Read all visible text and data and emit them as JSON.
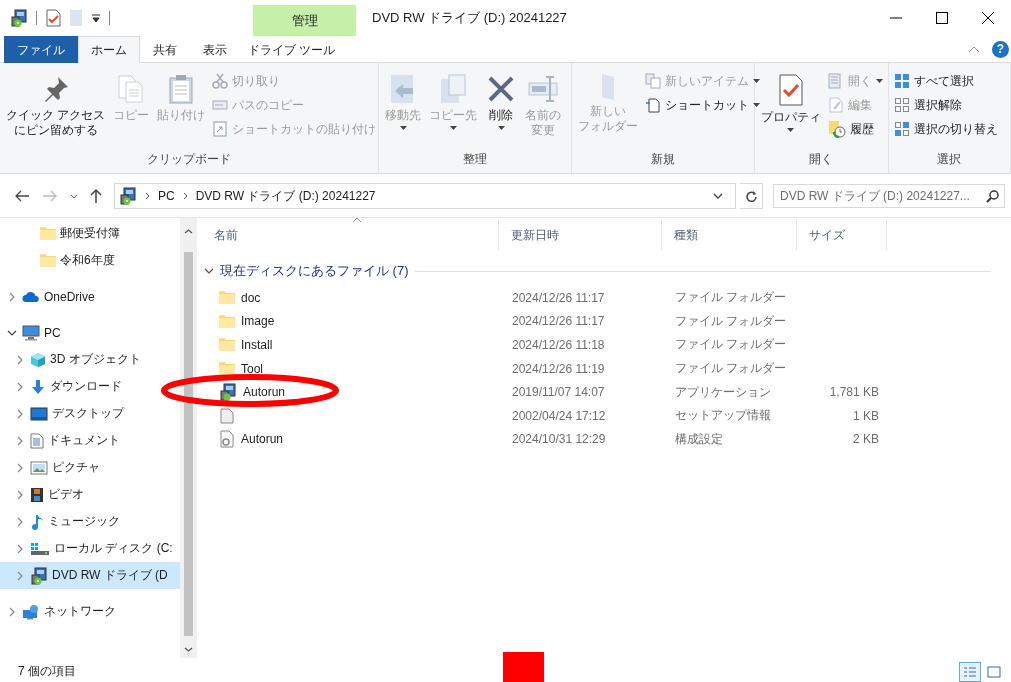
{
  "window": {
    "title": "DVD RW ドライブ (D:) 20241227",
    "context_tab_header": "管理"
  },
  "tabs": [
    {
      "label": "ファイル",
      "kind": "file",
      "selected": false
    },
    {
      "label": "ホーム",
      "kind": "tab",
      "selected": true
    },
    {
      "label": "共有",
      "kind": "tab",
      "selected": false
    },
    {
      "label": "表示",
      "kind": "tab",
      "selected": false
    },
    {
      "label": "ドライブ ツール",
      "kind": "context",
      "selected": false
    }
  ],
  "ribbon_groups": [
    {
      "label": "クリップボード",
      "items": [
        {
          "kind": "large",
          "label_lines": [
            "クイック アクセス",
            "にピン留めする"
          ],
          "disabled": false,
          "has_menu": false
        },
        {
          "kind": "large",
          "label": "コピー",
          "disabled": true,
          "has_menu": false
        },
        {
          "kind": "large",
          "label": "貼り付け",
          "disabled": true,
          "has_menu": false
        },
        {
          "kind": "small",
          "label": "切り取り",
          "disabled": true,
          "has_menu": false
        },
        {
          "kind": "small",
          "label": "パスのコピー",
          "disabled": true,
          "has_menu": false
        },
        {
          "kind": "small",
          "label": "ショートカットの貼り付け",
          "disabled": true,
          "has_menu": false
        }
      ]
    },
    {
      "label": "整理",
      "items": [
        {
          "kind": "large",
          "label": "移動先",
          "disabled": true,
          "has_menu": true
        },
        {
          "kind": "large",
          "label": "コピー先",
          "disabled": true,
          "has_menu": true
        },
        {
          "kind": "large",
          "label": "削除",
          "disabled": false,
          "has_menu": true
        },
        {
          "kind": "large",
          "label_lines": [
            "名前の",
            "変更"
          ],
          "disabled": true,
          "has_menu": false
        }
      ]
    },
    {
      "label": "新規",
      "items": [
        {
          "kind": "large",
          "label_lines": [
            "新しい",
            "フォルダー"
          ],
          "disabled": true,
          "has_menu": false
        },
        {
          "kind": "small",
          "label": "新しいアイテム",
          "disabled": true,
          "has_menu": true
        },
        {
          "kind": "small",
          "label": "ショートカット",
          "disabled": false,
          "has_menu": true
        }
      ]
    },
    {
      "label": "開く",
      "items": [
        {
          "kind": "large",
          "label": "プロパティ",
          "disabled": false,
          "has_menu": true
        },
        {
          "kind": "small",
          "label": "開く",
          "disabled": true,
          "has_menu": true
        },
        {
          "kind": "small",
          "label": "編集",
          "disabled": true,
          "has_menu": false
        },
        {
          "kind": "small",
          "label": "履歴",
          "disabled": false,
          "has_menu": false
        }
      ]
    },
    {
      "label": "選択",
      "items": [
        {
          "kind": "small",
          "label": "すべて選択",
          "disabled": false,
          "has_menu": false
        },
        {
          "kind": "small",
          "label": "選択解除",
          "disabled": false,
          "has_menu": false
        },
        {
          "kind": "small",
          "label": "選択の切り替え",
          "disabled": false,
          "has_menu": false
        }
      ]
    }
  ],
  "help_button": "?",
  "address_bar": {
    "breadcrumbs": [
      "PC",
      "DVD RW ドライブ (D:) 20241227"
    ]
  },
  "search": {
    "placeholder": "DVD RW ドライブ (D:) 20241227..."
  },
  "navigation_pane": {
    "quick_access_items": [
      {
        "label": "郵便受付簿",
        "kind": "folder",
        "selected": false
      },
      {
        "label": "令和6年度",
        "kind": "folder",
        "selected": false
      }
    ],
    "tree": [
      {
        "label": "OneDrive",
        "kind": "cloud",
        "expanded": false,
        "selected": false
      },
      {
        "label": "PC",
        "kind": "pc",
        "expanded": true,
        "selected": false,
        "children": [
          {
            "label": "3D オブジェクト",
            "kind": "cube",
            "expanded": false,
            "selected": false
          },
          {
            "label": "ダウンロード",
            "kind": "download",
            "expanded": false,
            "selected": false
          },
          {
            "label": "デスクトップ",
            "kind": "desktop",
            "expanded": false,
            "selected": false
          },
          {
            "label": "ドキュメント",
            "kind": "document",
            "expanded": false,
            "selected": false
          },
          {
            "label": "ピクチャ",
            "kind": "pictures",
            "expanded": false,
            "selected": false
          },
          {
            "label": "ビデオ",
            "kind": "video",
            "expanded": false,
            "selected": false
          },
          {
            "label": "ミュージック",
            "kind": "music",
            "expanded": false,
            "selected": false
          },
          {
            "label": "ローカル ディスク (C:",
            "kind": "drive",
            "expanded": false,
            "selected": false
          },
          {
            "label": "DVD RW ドライブ (D",
            "kind": "dvd",
            "expanded": false,
            "selected": true
          }
        ]
      },
      {
        "label": "ネットワーク",
        "kind": "network",
        "expanded": false,
        "selected": false
      }
    ]
  },
  "file_list": {
    "columns": [
      "名前",
      "更新日時",
      "種類",
      "サイズ"
    ],
    "group": {
      "label": "現在ディスクにあるファイル (7)",
      "expanded": true
    },
    "rows": [
      {
        "name": "doc",
        "modified": "2024/12/26 11:17",
        "type": "ファイル フォルダー",
        "kind": "folder",
        "selected": false
      },
      {
        "name": "Image",
        "modified": "2024/12/26 11:17",
        "type": "ファイル フォルダー",
        "kind": "folder",
        "selected": false
      },
      {
        "name": "Install",
        "modified": "2024/12/26 11:18",
        "type": "ファイル フォルダー",
        "kind": "folder",
        "selected": false
      },
      {
        "name": "Tool",
        "modified": "2024/12/26 11:19",
        "type": "ファイル フォルダー",
        "kind": "folder",
        "selected": false
      },
      {
        "name": "Autorun",
        "modified": "2019/11/07 14:07",
        "type": "アプリケーション",
        "size": "1,781 KB",
        "kind": "app",
        "selected": false
      },
      {
        "modified": "2002/04/24 17:12",
        "type": "セットアップ情報",
        "size": "1 KB",
        "kind": "inf",
        "selected": false
      },
      {
        "name": "Autorun",
        "modified": "2024/10/31 12:29",
        "type": "構成設定",
        "size": "2 KB",
        "kind": "config",
        "selected": false
      }
    ]
  },
  "status_bar": {
    "item_count": "7 個の項目",
    "views": [
      {
        "kind": "details",
        "selected": true
      },
      {
        "kind": "large_icons",
        "selected": false
      }
    ]
  }
}
